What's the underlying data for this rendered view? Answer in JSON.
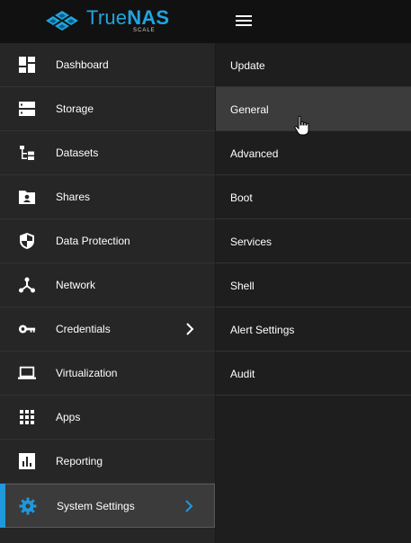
{
  "brand": {
    "name_light": "True",
    "name_bold": "NAS",
    "edition": "SCALE",
    "accent_color": "#1fa5e0"
  },
  "topbar": {
    "menu_icon": "hamburger-menu-icon"
  },
  "sidebar": {
    "items": [
      {
        "label": "Dashboard",
        "icon": "dashboard-icon"
      },
      {
        "label": "Storage",
        "icon": "storage-icon"
      },
      {
        "label": "Datasets",
        "icon": "datasets-icon"
      },
      {
        "label": "Shares",
        "icon": "shares-icon"
      },
      {
        "label": "Data Protection",
        "icon": "shield-icon"
      },
      {
        "label": "Network",
        "icon": "network-icon"
      },
      {
        "label": "Credentials",
        "icon": "key-icon",
        "has_submenu": true
      },
      {
        "label": "Virtualization",
        "icon": "laptop-icon"
      },
      {
        "label": "Apps",
        "icon": "apps-grid-icon"
      },
      {
        "label": "Reporting",
        "icon": "reporting-icon"
      },
      {
        "label": "System Settings",
        "icon": "gear-icon",
        "has_submenu": true,
        "active": true
      }
    ],
    "active_color": "#1f98dc"
  },
  "submenu": {
    "items": [
      {
        "label": "Update"
      },
      {
        "label": "General",
        "hovered": true
      },
      {
        "label": "Advanced"
      },
      {
        "label": "Boot"
      },
      {
        "label": "Services"
      },
      {
        "label": "Shell"
      },
      {
        "label": "Alert Settings"
      },
      {
        "label": "Audit"
      }
    ]
  }
}
